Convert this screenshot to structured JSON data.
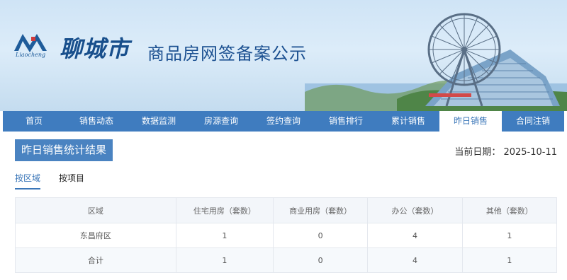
{
  "header": {
    "logo_text": "Liaocheng",
    "city_name": "聊城市",
    "site_title": "商品房网签备案公示"
  },
  "nav": {
    "items": [
      {
        "label": "首页"
      },
      {
        "label": "销售动态"
      },
      {
        "label": "数据监测"
      },
      {
        "label": "房源查询"
      },
      {
        "label": "签约查询"
      },
      {
        "label": "销售排行"
      },
      {
        "label": "累计销售"
      },
      {
        "label": "昨日销售"
      },
      {
        "label": "合同注销"
      }
    ],
    "active": "昨日销售"
  },
  "main": {
    "section_button": "昨日销售统计结果",
    "date_label": "当前日期：",
    "date_value": "2025-10-11",
    "tabs": [
      {
        "label": "按区域"
      },
      {
        "label": "按项目"
      }
    ],
    "table": {
      "headers": [
        "区域",
        "住宅用房（套数）",
        "商业用房（套数）",
        "办公（套数）",
        "其他（套数）"
      ],
      "rows": [
        [
          "东昌府区",
          "1",
          "0",
          "4",
          "1"
        ],
        [
          "合计",
          "1",
          "0",
          "4",
          "1"
        ]
      ]
    }
  },
  "colors": {
    "nav_bg": "#3f7cbf",
    "accent": "#3a76b8",
    "button_bg": "#4a83c1"
  }
}
